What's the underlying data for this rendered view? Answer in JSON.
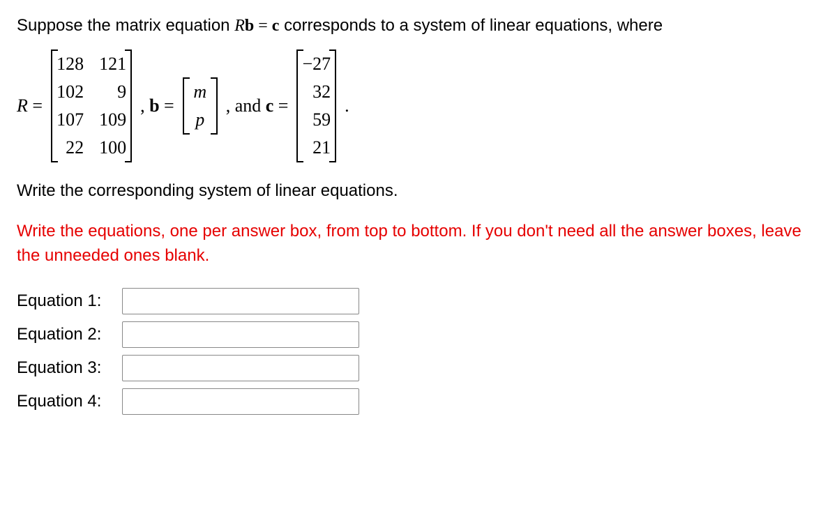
{
  "intro": {
    "pre": "Suppose the matrix equation ",
    "R": "R",
    "b": "b",
    "eq": " = ",
    "c": "c",
    "post": " corresponds to a system of linear equations, where"
  },
  "matrices": {
    "R_label": "R",
    "R_eq": " = ",
    "R": [
      [
        "128",
        "121"
      ],
      [
        "102",
        "9"
      ],
      [
        "107",
        "109"
      ],
      [
        "22",
        "100"
      ]
    ],
    "comma1": ", ",
    "b_label": "b",
    "b_eq": " = ",
    "b": [
      "m",
      "p"
    ],
    "comma2": ", and ",
    "c_label": "c",
    "c_eq": " = ",
    "c": [
      "−27",
      "32",
      "59",
      "21"
    ],
    "period": "."
  },
  "instruction": "Write the corresponding system of linear equations.",
  "rednote": "Write the equations, one per answer box, from top to bottom. If you don't need all the answer boxes, leave the unneeded ones blank.",
  "labels": {
    "eq1": "Equation 1:",
    "eq2": "Equation 2:",
    "eq3": "Equation 3:",
    "eq4": "Equation 4:"
  }
}
